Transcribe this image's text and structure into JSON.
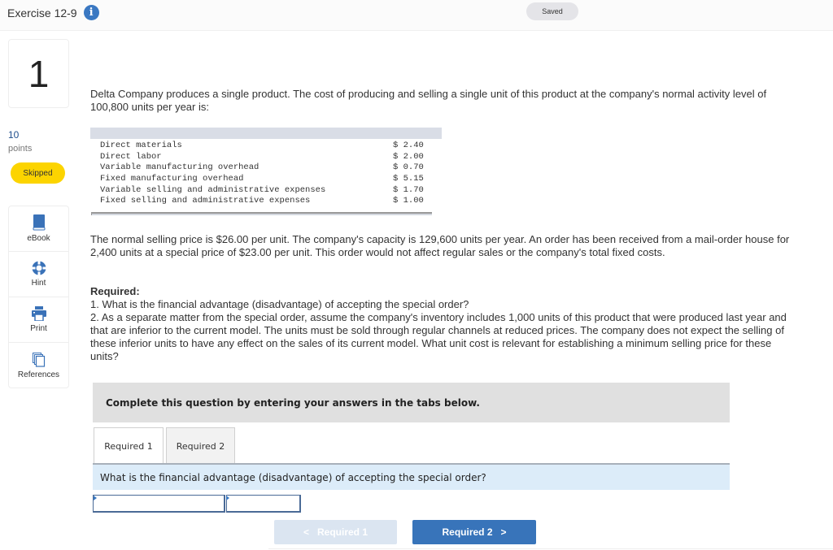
{
  "header": {
    "exercise_title": "Exercise 12-9",
    "info_icon": "info-icon",
    "saved_label": "Saved"
  },
  "question": {
    "number": "1",
    "points_value": "10",
    "points_label": "points",
    "status_badge": "Skipped"
  },
  "tools": [
    {
      "label": "eBook",
      "icon": "book-icon"
    },
    {
      "label": "Hint",
      "icon": "lifebuoy-icon"
    },
    {
      "label": "Print",
      "icon": "printer-icon"
    },
    {
      "label": "References",
      "icon": "documents-icon"
    }
  ],
  "content": {
    "intro": "Delta Company produces a single product. The cost of producing and selling a single unit of this product at the company's normal activity level of 100,800 units per year is:",
    "cost_table": [
      {
        "label": "Direct materials",
        "value": "$ 2.40"
      },
      {
        "label": "Direct labor",
        "value": "$ 2.00"
      },
      {
        "label": "Variable manufacturing overhead",
        "value": "$ 0.70"
      },
      {
        "label": "Fixed manufacturing overhead",
        "value": "$ 5.15"
      },
      {
        "label": "Variable selling and administrative expenses",
        "value": "$ 1.70"
      },
      {
        "label": "Fixed selling and administrative expenses",
        "value": "$ 1.00"
      }
    ],
    "price_paragraph": "The normal selling price is $26.00 per unit. The company's capacity is 129,600 units per year. An order has been received from a mail-order house for 2,400 units at a special price of $23.00 per unit. This order would not affect regular sales or the company's total fixed costs.",
    "required_title": "Required:",
    "required_1": "1. What is the financial advantage (disadvantage) of accepting the special order?",
    "required_2": "2. As a separate matter from the special order, assume the company's inventory includes 1,000 units of this product that were produced last year and that are inferior to the current model. The units must be sold through regular channels at reduced prices. The company does not expect the selling of these inferior units to have any effect on the sales of its current model. What unit cost is relevant for establishing a minimum selling price for these units?"
  },
  "answer_area": {
    "instruction": "Complete this question by entering your answers in the tabs below.",
    "tabs": [
      {
        "label": "Required 1",
        "active": true
      },
      {
        "label": "Required 2",
        "active": false
      }
    ],
    "question_text": "What is the financial advantage (disadvantage) of accepting the special order?",
    "input_1_value": "",
    "input_2_value": "",
    "prev_button": "Required 1",
    "next_button": "Required 2"
  },
  "colors": {
    "accent_blue": "#3874ba",
    "skipped_yellow": "#fcd400",
    "question_bar": "#dcecf9",
    "instruction_bg": "#e0e0e0"
  }
}
